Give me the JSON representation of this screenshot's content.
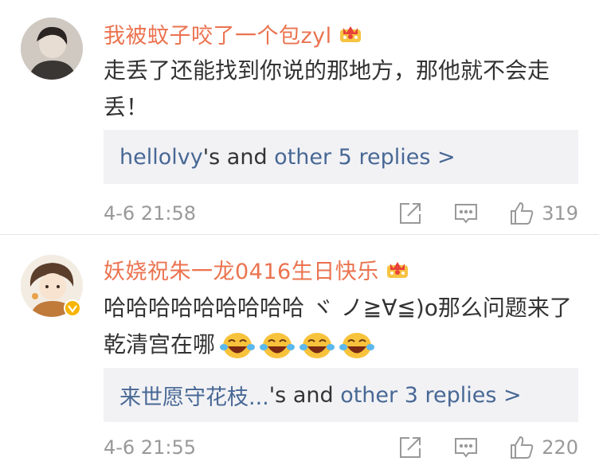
{
  "comments": [
    {
      "username": "我被蚊子咬了一个包zyl",
      "text": "走丢了还能找到你说的那地方，那他就不会走丢！",
      "replies": {
        "user": "hellolvy",
        "middle": "'s and ",
        "link": "other 5 replies >"
      },
      "time": "4-6 21:58",
      "likes": "319",
      "avatar_icon": "user-avatar",
      "badge_icon": "crown-icon"
    },
    {
      "username": "妖娆祝朱一龙0416生日快乐",
      "text": "哈哈哈哈哈哈哈哈哈 ヾ ノ≧∀≦)o那么问题来了 乾清宫在哪",
      "emoji_count": 4,
      "emoji_icon": "laugh-cry-emoji",
      "replies": {
        "user": "来世愿守花枝...",
        "middle": "'s and ",
        "link": "other 3 replies >"
      },
      "time": "4-6 21:55",
      "likes": "220",
      "avatar_icon": "user-avatar",
      "badge_icon": "crown-icon",
      "verified_icon": "verified-badge-icon"
    }
  ],
  "colors": {
    "username": "#eb7350",
    "link": "#486895",
    "meta": "#999999",
    "reply_bg": "#f2f2f5"
  },
  "icons": {
    "share": "share-icon",
    "comment": "comment-icon",
    "like": "thumbs-up-icon"
  }
}
